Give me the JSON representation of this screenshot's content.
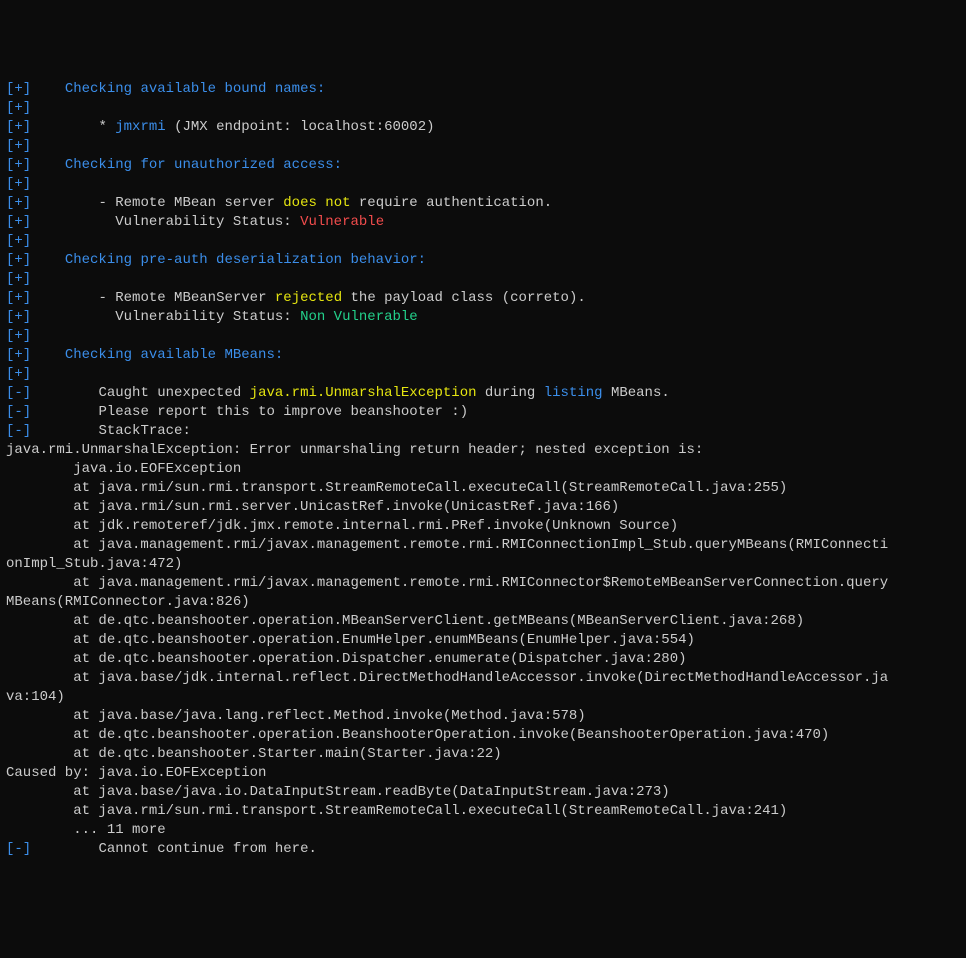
{
  "t": {
    "plus": "[+]",
    "minus": "[-]",
    "sp4": "    ",
    "sp6": "      ",
    "sp7": "       ",
    "sp8": "        ",
    "star": "* ",
    "dash": "- ",
    "check_bound": "Checking available bound names:",
    "jmxrmi": "jmxrmi",
    "jmxrmi_after": " (JMX endpoint: localhost:60002)",
    "check_unauth": "Checking for unauthorized access:",
    "remote_mbean_pre": "Remote MBean server ",
    "does_not": "does not",
    "require_auth": " require authentication.",
    "vuln_status_pre": "  Vulnerability Status: ",
    "vulnerable": "Vulnerable",
    "check_deser": "Checking pre-auth deserialization behavior:",
    "remote_mbsrv_pre": "Remote MBeanServer ",
    "rejected": "rejected",
    "payload_class": " the payload class (correto).",
    "non_vulnerable": "Non Vulnerable",
    "check_mbeans": "Checking available MBeans:",
    "caught_pre": "Caught unexpected ",
    "unmarshal_ex": "java.rmi.UnmarshalException",
    "during": " during ",
    "listing": "listing",
    "mbeans_suffix": " MBeans.",
    "please_report": "Please report this to improve beanshooter :)",
    "stacktrace": "StackTrace:",
    "st0": "java.rmi.UnmarshalException: Error unmarshaling return header; nested exception is:",
    "st1": "        java.io.EOFException",
    "st2": "        at java.rmi/sun.rmi.transport.StreamRemoteCall.executeCall(StreamRemoteCall.java:255)",
    "st3": "        at java.rmi/sun.rmi.server.UnicastRef.invoke(UnicastRef.java:166)",
    "st4": "        at jdk.remoteref/jdk.jmx.remote.internal.rmi.PRef.invoke(Unknown Source)",
    "st5": "        at java.management.rmi/javax.management.remote.rmi.RMIConnectionImpl_Stub.queryMBeans(RMIConnecti",
    "st5b": "onImpl_Stub.java:472)",
    "st6": "        at java.management.rmi/javax.management.remote.rmi.RMIConnector$RemoteMBeanServerConnection.query",
    "st6b": "MBeans(RMIConnector.java:826)",
    "st7": "        at de.qtc.beanshooter.operation.MBeanServerClient.getMBeans(MBeanServerClient.java:268)",
    "st8": "        at de.qtc.beanshooter.operation.EnumHelper.enumMBeans(EnumHelper.java:554)",
    "st9": "        at de.qtc.beanshooter.operation.Dispatcher.enumerate(Dispatcher.java:280)",
    "st10": "        at java.base/jdk.internal.reflect.DirectMethodHandleAccessor.invoke(DirectMethodHandleAccessor.ja",
    "st10b": "va:104)",
    "st11": "        at java.base/java.lang.reflect.Method.invoke(Method.java:578)",
    "st12": "        at de.qtc.beanshooter.operation.BeanshooterOperation.invoke(BeanshooterOperation.java:470)",
    "st13": "        at de.qtc.beanshooter.Starter.main(Starter.java:22)",
    "st14": "Caused by: java.io.EOFException",
    "st15": "        at java.base/java.io.DataInputStream.readByte(DataInputStream.java:273)",
    "st16": "        at java.rmi/sun.rmi.transport.StreamRemoteCall.executeCall(StreamRemoteCall.java:241)",
    "st17": "        ... 11 more",
    "cannot_continue": "Cannot continue from here."
  }
}
